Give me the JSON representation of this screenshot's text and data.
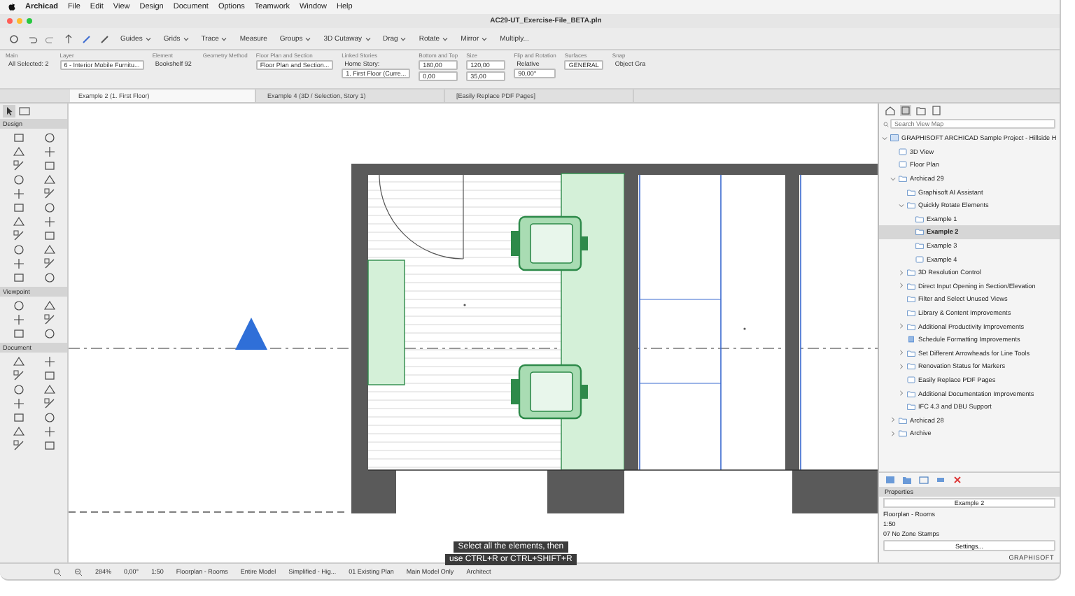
{
  "menu_bar": {
    "app": "Archicad",
    "items": [
      "File",
      "Edit",
      "View",
      "Design",
      "Document",
      "Options",
      "Teamwork",
      "Window",
      "Help"
    ]
  },
  "window": {
    "title": "AC29-UT_Exercise-File_BETA.pln"
  },
  "toolbar": [
    {
      "label": "Guides",
      "kind": "dropdown"
    },
    {
      "label": "Grids",
      "kind": "dropdown"
    },
    {
      "label": "Trace",
      "kind": "dropdown"
    },
    {
      "label": "Measure",
      "kind": "button"
    },
    {
      "label": "Groups",
      "kind": "dropdown"
    },
    {
      "label": "3D Cutaway",
      "kind": "dropdown"
    },
    {
      "label": "Drag",
      "kind": "dropdown"
    },
    {
      "label": "Rotate",
      "kind": "dropdown"
    },
    {
      "label": "Mirror",
      "kind": "dropdown"
    },
    {
      "label": "Multiply...",
      "kind": "button"
    }
  ],
  "info_box": [
    {
      "label": "Main",
      "values": [
        {
          "text": "All Selected: 2",
          "kind": "text"
        }
      ]
    },
    {
      "label": "Layer",
      "values": [
        {
          "text": "6 - Interior Mobile Furnitu...",
          "kind": "field"
        }
      ]
    },
    {
      "label": "Element",
      "values": [
        {
          "text": "Bookshelf 92",
          "kind": "text"
        }
      ]
    },
    {
      "label": "Geometry Method"
    },
    {
      "label": "Floor Plan and Section",
      "values": [
        {
          "text": "Floor Plan and Section...",
          "kind": "field"
        }
      ]
    },
    {
      "label": "Linked Stories",
      "values": [
        {
          "text": "Home Story:",
          "kind": "text"
        },
        {
          "text": "1. First Floor (Curre...",
          "kind": "field"
        }
      ]
    },
    {
      "label": "Bottom and Top",
      "values": [
        {
          "text": "180,00",
          "kind": "field"
        },
        {
          "text": "0,00",
          "kind": "field"
        }
      ]
    },
    {
      "label": "Size",
      "values": [
        {
          "text": "120,00",
          "kind": "field"
        },
        {
          "text": "35,00",
          "kind": "field"
        }
      ]
    },
    {
      "label": "Flip and Rotation",
      "values": [
        {
          "text": "Relative",
          "kind": "text"
        },
        {
          "text": "90,00°",
          "kind": "field"
        }
      ]
    },
    {
      "label": "Surfaces",
      "values": [
        {
          "text": "GENERAL",
          "kind": "field"
        }
      ]
    },
    {
      "label": "Snap",
      "values": [
        {
          "text": "Object Gra",
          "kind": "text"
        }
      ]
    }
  ],
  "view_tabs": [
    {
      "label": "Example 2 (1. First Floor)",
      "selected": true
    },
    {
      "label": "Example 4 (3D / Selection, Story 1)",
      "selected": false
    },
    {
      "label": "[Easily Replace PDF Pages]",
      "selected": false
    }
  ],
  "toolbox": [
    {
      "title": "Design",
      "expanded": true
    },
    {
      "title": "Viewpoint",
      "expanded": true
    },
    {
      "title": "Document",
      "expanded": true
    }
  ],
  "navigator": {
    "search": {
      "placeholder": "Search View Map"
    },
    "tree": [
      {
        "label": "GRAPHISOFT ARCHICAD Sample Project - Hillside H",
        "kind": "project",
        "expanded": true,
        "selected": false,
        "children": [
          {
            "label": "3D View",
            "kind": "view",
            "selected": false
          },
          {
            "label": "Floor Plan",
            "kind": "view",
            "selected": false
          },
          {
            "label": "Archicad 29",
            "kind": "folder",
            "expanded": true,
            "selected": false,
            "children": [
              {
                "label": "Graphisoft AI Assistant",
                "kind": "folder",
                "selected": false
              },
              {
                "label": "Quickly Rotate Elements",
                "kind": "folder",
                "expanded": true,
                "selected": false,
                "children": [
                  {
                    "label": "Example 1",
                    "kind": "folder",
                    "selected": false
                  },
                  {
                    "label": "Example 2",
                    "kind": "folder",
                    "selected": true
                  },
                  {
                    "label": "Example 3",
                    "kind": "folder",
                    "selected": false
                  },
                  {
                    "label": "Example 4",
                    "kind": "view",
                    "selected": false
                  }
                ]
              },
              {
                "label": "3D Resolution Control",
                "kind": "folder",
                "expanded": false,
                "selected": false
              },
              {
                "label": "Direct Input Opening in Section/Elevation",
                "kind": "folder",
                "expanded": false,
                "selected": false
              },
              {
                "label": "Filter and Select Unused Views",
                "kind": "folder",
                "selected": false
              },
              {
                "label": "Library & Content Improvements",
                "kind": "folder",
                "selected": false
              },
              {
                "label": "Additional Productivity Improvements",
                "kind": "folder",
                "expanded": false,
                "selected": false
              },
              {
                "label": "Schedule Formatting Improvements",
                "kind": "schedule",
                "selected": false
              },
              {
                "label": "Set Different Arrowheads for Line Tools",
                "kind": "folder",
                "expanded": false,
                "selected": false
              },
              {
                "label": "Renovation Status for Markers",
                "kind": "folder",
                "expanded": false,
                "selected": false
              },
              {
                "label": "Easily Replace PDF Pages",
                "kind": "view",
                "selected": false
              },
              {
                "label": "Additional Documentation Improvements",
                "kind": "folder",
                "expanded": false,
                "selected": false
              },
              {
                "label": "IFC 4.3 and DBU Support",
                "kind": "folder",
                "selected": false
              }
            ]
          },
          {
            "label": "Archicad 28",
            "kind": "folder",
            "expanded": false,
            "selected": false
          },
          {
            "label": "Archive",
            "kind": "folder",
            "expanded": false,
            "selected": false
          }
        ]
      }
    ]
  },
  "properties": {
    "title": "Properties",
    "name": "Example 2",
    "rows": [
      "Floorplan - Rooms",
      "1:50",
      "07 No Zone Stamps"
    ],
    "button": "Settings...",
    "brand": "GRAPHISOFT"
  },
  "status_bar": [
    "284%",
    "0,00°",
    "1:50",
    "Floorplan - Rooms",
    "Entire Model",
    "Simplified - Hig...",
    "01 Existing Plan",
    "Main Model Only",
    "Architect"
  ],
  "caption": [
    "Select all the elements, then",
    "use CTRL+R or CTRL+SHIFT+R"
  ]
}
